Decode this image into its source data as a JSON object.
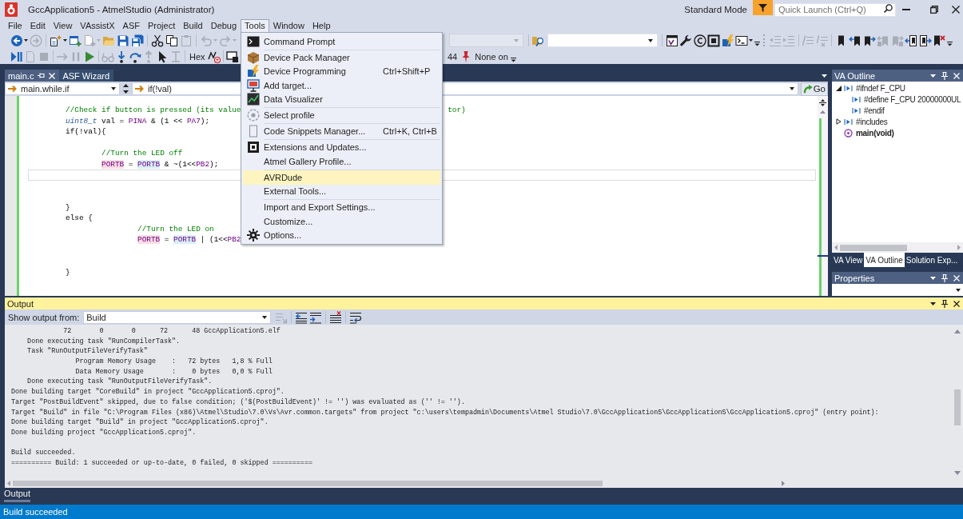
{
  "window": {
    "title": "GccApplication5 - AtmelStudio (Administrator)",
    "mode": "Standard Mode",
    "quick_launch": {
      "placeholder": "Quick Launch (Ctrl+Q)"
    }
  },
  "menu_bar": [
    {
      "label": "File",
      "selected": false
    },
    {
      "label": "Edit",
      "selected": false
    },
    {
      "label": "View",
      "selected": false
    },
    {
      "label": "VAssistX",
      "selected": false
    },
    {
      "label": "ASF",
      "selected": false
    },
    {
      "label": "Project",
      "selected": false
    },
    {
      "label": "Build",
      "selected": false
    },
    {
      "label": "Debug",
      "selected": false
    },
    {
      "label": "Tools",
      "selected": true,
      "items": [
        {
          "kind": "terminal",
          "label": "Command Prompt",
          "selected": false
        },
        {
          "kind": "separator"
        },
        {
          "kind": "package",
          "label": "Device Pack Manager",
          "selected": false
        },
        {
          "kind": "programming",
          "label": "Device Programming",
          "shortcut": "Ctrl+Shift+P",
          "selected": false
        },
        {
          "kind": "target",
          "label": "Add target...",
          "selected": false
        },
        {
          "kind": "visualizer",
          "label": "Data Visualizer",
          "selected": false
        },
        {
          "kind": "separator"
        },
        {
          "kind": "profile",
          "label": "Select profile",
          "selected": false
        },
        {
          "kind": "separator"
        },
        {
          "kind": "snippets",
          "label": "Code Snippets Manager...",
          "shortcut": "Ctrl+K, Ctrl+B",
          "selected": false
        },
        {
          "kind": "separator"
        },
        {
          "kind": "extensions",
          "label": "Extensions and Updates...",
          "selected": false
        },
        {
          "kind": "plain",
          "label": "Atmel Gallery Profile...",
          "selected": false
        },
        {
          "kind": "separator"
        },
        {
          "kind": "plain",
          "label": "AVRDude",
          "selected": true
        },
        {
          "kind": "plain",
          "label": "External Tools...",
          "selected": false
        },
        {
          "kind": "separator"
        },
        {
          "kind": "plain",
          "label": "Import and Export Settings...",
          "selected": false
        },
        {
          "kind": "plain",
          "label": "Customize...",
          "selected": false
        },
        {
          "kind": "options",
          "label": "Options...",
          "selected": false
        }
      ]
    },
    {
      "label": "Window",
      "selected": false
    },
    {
      "label": "Help",
      "selected": false
    }
  ],
  "toolbar_top": {
    "left": [
      {
        "kind": "back",
        "disabled": false,
        "dropdown": true
      },
      {
        "kind": "forward",
        "disabled": true,
        "dropdown": false
      },
      {
        "kind": "separator"
      },
      {
        "kind": "newproject",
        "disabled": false,
        "dropdown": true
      },
      {
        "kind": "additem",
        "disabled": false,
        "dropdown": false
      },
      {
        "kind": "addexisting",
        "disabled": true,
        "dropdown": true
      },
      {
        "kind": "open",
        "disabled": false,
        "dropdown": false
      },
      {
        "kind": "save",
        "disabled": false,
        "dropdown": false
      },
      {
        "kind": "saveall",
        "disabled": false,
        "dropdown": false
      },
      {
        "kind": "separator"
      },
      {
        "kind": "cut",
        "disabled": false,
        "dropdown": false
      },
      {
        "kind": "copy",
        "disabled": false,
        "dropdown": false
      },
      {
        "kind": "paste",
        "disabled": true,
        "dropdown": false
      },
      {
        "kind": "separator"
      },
      {
        "kind": "undo",
        "disabled": true,
        "dropdown": true
      },
      {
        "kind": "redo",
        "disabled": true,
        "dropdown": true
      }
    ],
    "right": [
      {
        "kind": "configcombo",
        "disabled": true
      },
      {
        "kind": "separator"
      },
      {
        "kind": "findfiles",
        "disabled": false,
        "dropdown": false
      },
      {
        "kind": "findcombo",
        "disabled": false
      },
      {
        "kind": "separator"
      },
      {
        "kind": "solution",
        "disabled": false,
        "dropdown": false
      },
      {
        "kind": "wrench",
        "disabled": false,
        "dropdown": false
      },
      {
        "kind": "copyright",
        "disabled": false,
        "dropdown": false
      },
      {
        "kind": "chip",
        "disabled": false,
        "dropdown": false
      },
      {
        "kind": "programmer",
        "disabled": false,
        "dropdown": false
      },
      {
        "kind": "terminal",
        "disabled": false,
        "dropdown": true
      },
      {
        "kind": "overflow",
        "disabled": false,
        "dropdown": false
      },
      {
        "kind": "grip"
      },
      {
        "kind": "outdent",
        "disabled": true,
        "dropdown": false
      },
      {
        "kind": "indent",
        "disabled": true,
        "dropdown": false
      },
      {
        "kind": "separator"
      },
      {
        "kind": "comment",
        "disabled": true,
        "dropdown": false
      },
      {
        "kind": "uncomment",
        "disabled": true,
        "dropdown": false
      },
      {
        "kind": "separator"
      },
      {
        "kind": "bookmark",
        "disabled": false,
        "dropdown": false
      },
      {
        "kind": "bmprev",
        "disabled": false,
        "dropdown": false
      },
      {
        "kind": "bmnext",
        "disabled": false,
        "dropdown": false
      },
      {
        "kind": "bmfolderprev",
        "disabled": true,
        "dropdown": false
      },
      {
        "kind": "bmfoldernext",
        "disabled": true,
        "dropdown": false
      },
      {
        "kind": "bmfileprev",
        "disabled": false,
        "dropdown": false
      },
      {
        "kind": "bmfilenext",
        "disabled": false,
        "dropdown": false
      },
      {
        "kind": "bmclear",
        "disabled": false,
        "dropdown": false
      },
      {
        "kind": "overflow",
        "disabled": false,
        "dropdown": false
      }
    ]
  },
  "toolbar_debug": {
    "left": [
      {
        "kind": "startdebug",
        "disabled": false,
        "dropdown": false
      },
      {
        "kind": "newfile",
        "disabled": true,
        "dropdown": false
      },
      {
        "kind": "stop",
        "disabled": true,
        "dropdown": false
      },
      {
        "kind": "separator"
      },
      {
        "kind": "nextstatement",
        "disabled": true,
        "dropdown": false
      },
      {
        "kind": "pause",
        "disabled": true,
        "dropdown": false
      },
      {
        "kind": "continue",
        "disabled": false,
        "dropdown": false
      },
      {
        "kind": "separator"
      },
      {
        "kind": "glasses",
        "disabled": true,
        "dropdown": false
      },
      {
        "kind": "stepinto",
        "disabled": false,
        "dropdown": false
      },
      {
        "kind": "stepover",
        "disabled": false,
        "dropdown": false
      },
      {
        "kind": "stepout",
        "disabled": true,
        "dropdown": false
      },
      {
        "kind": "cursor",
        "disabled": false,
        "dropdown": false
      },
      {
        "kind": "textcursor",
        "disabled": true,
        "dropdown": false
      },
      {
        "kind": "separator"
      },
      {
        "kind": "textbutton",
        "label": "Hex",
        "disabled": false
      },
      {
        "kind": "hextoggle",
        "disabled": false,
        "dropdown": false
      },
      {
        "kind": "separator"
      },
      {
        "kind": "window",
        "disabled": false,
        "dropdown": false
      }
    ],
    "right": [
      {
        "kind": "label",
        "label": "44",
        "disabled": false
      },
      {
        "kind": "pin",
        "disabled": false,
        "dropdown": false
      },
      {
        "kind": "label",
        "label": "None on",
        "disabled": false
      },
      {
        "kind": "overflow",
        "disabled": false,
        "dropdown": false
      }
    ]
  },
  "editor": {
    "tabs": [
      {
        "label": "main.c",
        "selected": true
      },
      {
        "label": "ASF Wizard",
        "selected": false
      }
    ],
    "scope": "main.while.if",
    "member": "if(!val)",
    "go": "Go",
    "lines": [
      {
        "kind": "code",
        "tokens": [
          {
            "text": "        //Check if button is pressed (its value",
            "kind": "comment"
          }
        ],
        "tail": [
          {
            "text": "tor)",
            "kind": "comment"
          }
        ]
      },
      {
        "kind": "code",
        "tokens": [
          {
            "text": "        uint8_t",
            "kind": "type"
          },
          {
            "text": " val = ",
            "kind": "plain"
          },
          {
            "text": "PINA",
            "kind": "macro"
          },
          {
            "text": " & (1 << ",
            "kind": "plain"
          },
          {
            "text": "PA7",
            "kind": "macro"
          },
          {
            "text": ");",
            "kind": "plain"
          }
        ]
      },
      {
        "kind": "code",
        "tokens": [
          {
            "text": "        if(!val){",
            "kind": "plain"
          }
        ]
      },
      {
        "kind": "blank"
      },
      {
        "kind": "code",
        "tokens": [
          {
            "text": "                //Turn the LED off",
            "kind": "comment"
          }
        ]
      },
      {
        "kind": "code",
        "tokens": [
          {
            "text": "                PORTB",
            "kind": "write"
          },
          {
            "text": " = ",
            "kind": "plain"
          },
          {
            "text": "PORTB",
            "kind": "read"
          },
          {
            "text": " & ~(1<<",
            "kind": "plain"
          },
          {
            "text": "PB2",
            "kind": "macro"
          },
          {
            "text": ");",
            "kind": "plain"
          }
        ]
      },
      {
        "kind": "caret"
      },
      {
        "kind": "blank"
      },
      {
        "kind": "blank"
      },
      {
        "kind": "code",
        "tokens": [
          {
            "text": "        }",
            "kind": "plain"
          }
        ]
      },
      {
        "kind": "code",
        "tokens": [
          {
            "text": "        else {",
            "kind": "plain"
          }
        ]
      },
      {
        "kind": "code",
        "tokens": [
          {
            "text": "                        //Turn the LED on",
            "kind": "comment"
          }
        ]
      },
      {
        "kind": "code",
        "tokens": [
          {
            "text": "                        PORTB",
            "kind": "write"
          },
          {
            "text": " = ",
            "kind": "plain"
          },
          {
            "text": "PORTB",
            "kind": "read"
          },
          {
            "text": " | (1<<",
            "kind": "plain"
          },
          {
            "text": "PB2",
            "kind": "macro"
          }
        ]
      },
      {
        "kind": "blank"
      },
      {
        "kind": "blank"
      },
      {
        "kind": "code",
        "tokens": [
          {
            "text": "        }",
            "kind": "plain"
          }
        ]
      }
    ]
  },
  "va_outline": {
    "title": "VA Outline",
    "items": [
      {
        "kind": "directive",
        "label": "#ifndef F_CPU",
        "expanded": true,
        "children": [
          {
            "kind": "directive",
            "label": "#define F_CPU 20000000UL"
          },
          {
            "kind": "directive",
            "label": "#endif"
          }
        ]
      },
      {
        "kind": "directive",
        "label": "#includes",
        "expanded": false
      },
      {
        "kind": "function",
        "label": "main(void)"
      }
    ],
    "tabs": [
      {
        "label": "VA View",
        "selected": false
      },
      {
        "label": "VA Outline",
        "selected": true
      },
      {
        "label": "Solution Exp...",
        "selected": false
      }
    ]
  },
  "properties": {
    "title": "Properties"
  },
  "output": {
    "title": "Output",
    "source_label": "Show output from:",
    "source": "Build",
    "tools": [
      {
        "kind": "goto",
        "disabled": true
      },
      {
        "kind": "separator"
      },
      {
        "kind": "prevmsg",
        "disabled": false
      },
      {
        "kind": "nextmsg",
        "disabled": false
      },
      {
        "kind": "separator"
      },
      {
        "kind": "clear",
        "disabled": false
      },
      {
        "kind": "separator"
      },
      {
        "kind": "wrap",
        "disabled": false
      }
    ],
    "log": [
      "             72       0       0      72      48 GccApplication5.elf",
      "    Done executing task \"RunCompilerTask\".",
      "    Task \"RunOutputFileVerifyTask\"",
      "                Program Memory Usage    :   72 bytes   1,8 % Full",
      "                Data Memory Usage       :    0 bytes   0,0 % Full",
      "    Done executing task \"RunOutputFileVerifyTask\".",
      "Done building target \"CoreBuild\" in project \"GccApplication5.cproj\".",
      "Target \"PostBuildEvent\" skipped, due to false condition; ('$(PostBuildEvent)' != '') was evaluated as ('' != '').",
      "Target \"Build\" in file \"C:\\Program Files (x86)\\Atmel\\Studio\\7.0\\Vs\\Avr.common.targets\" from project \"c:\\users\\tempadmin\\Documents\\Atmel Studio\\7.0\\GccApplication5\\GccApplication5\\GccApplication5.cproj\" (entry point):",
      "Done building target \"Build\" in project \"GccApplication5.cproj\".",
      "Done building project \"GccApplication5.cproj\"."
    ],
    "summary": [
      "Build succeeded.",
      "========== Build: 1 succeeded or up-to-date, 0 failed, 0 skipped =========="
    ],
    "tabs": [
      {
        "label": "Output",
        "selected": true
      }
    ]
  },
  "status_bar": {
    "text": "Build succeeded"
  }
}
